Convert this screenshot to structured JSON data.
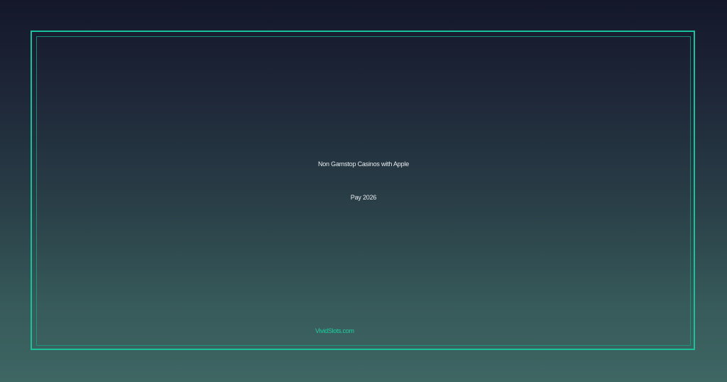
{
  "banner": {
    "title_line_1": "Non Gamstop Casinos with Apple",
    "title_line_2": "Pay 2026",
    "brand": "VividSlots.com"
  },
  "colors": {
    "frame": "#19c29a",
    "brand_text": "#1ed0a2",
    "title_text": "#e8ecef",
    "bg_top": "#14172a",
    "bg_bottom": "#3e6663"
  }
}
